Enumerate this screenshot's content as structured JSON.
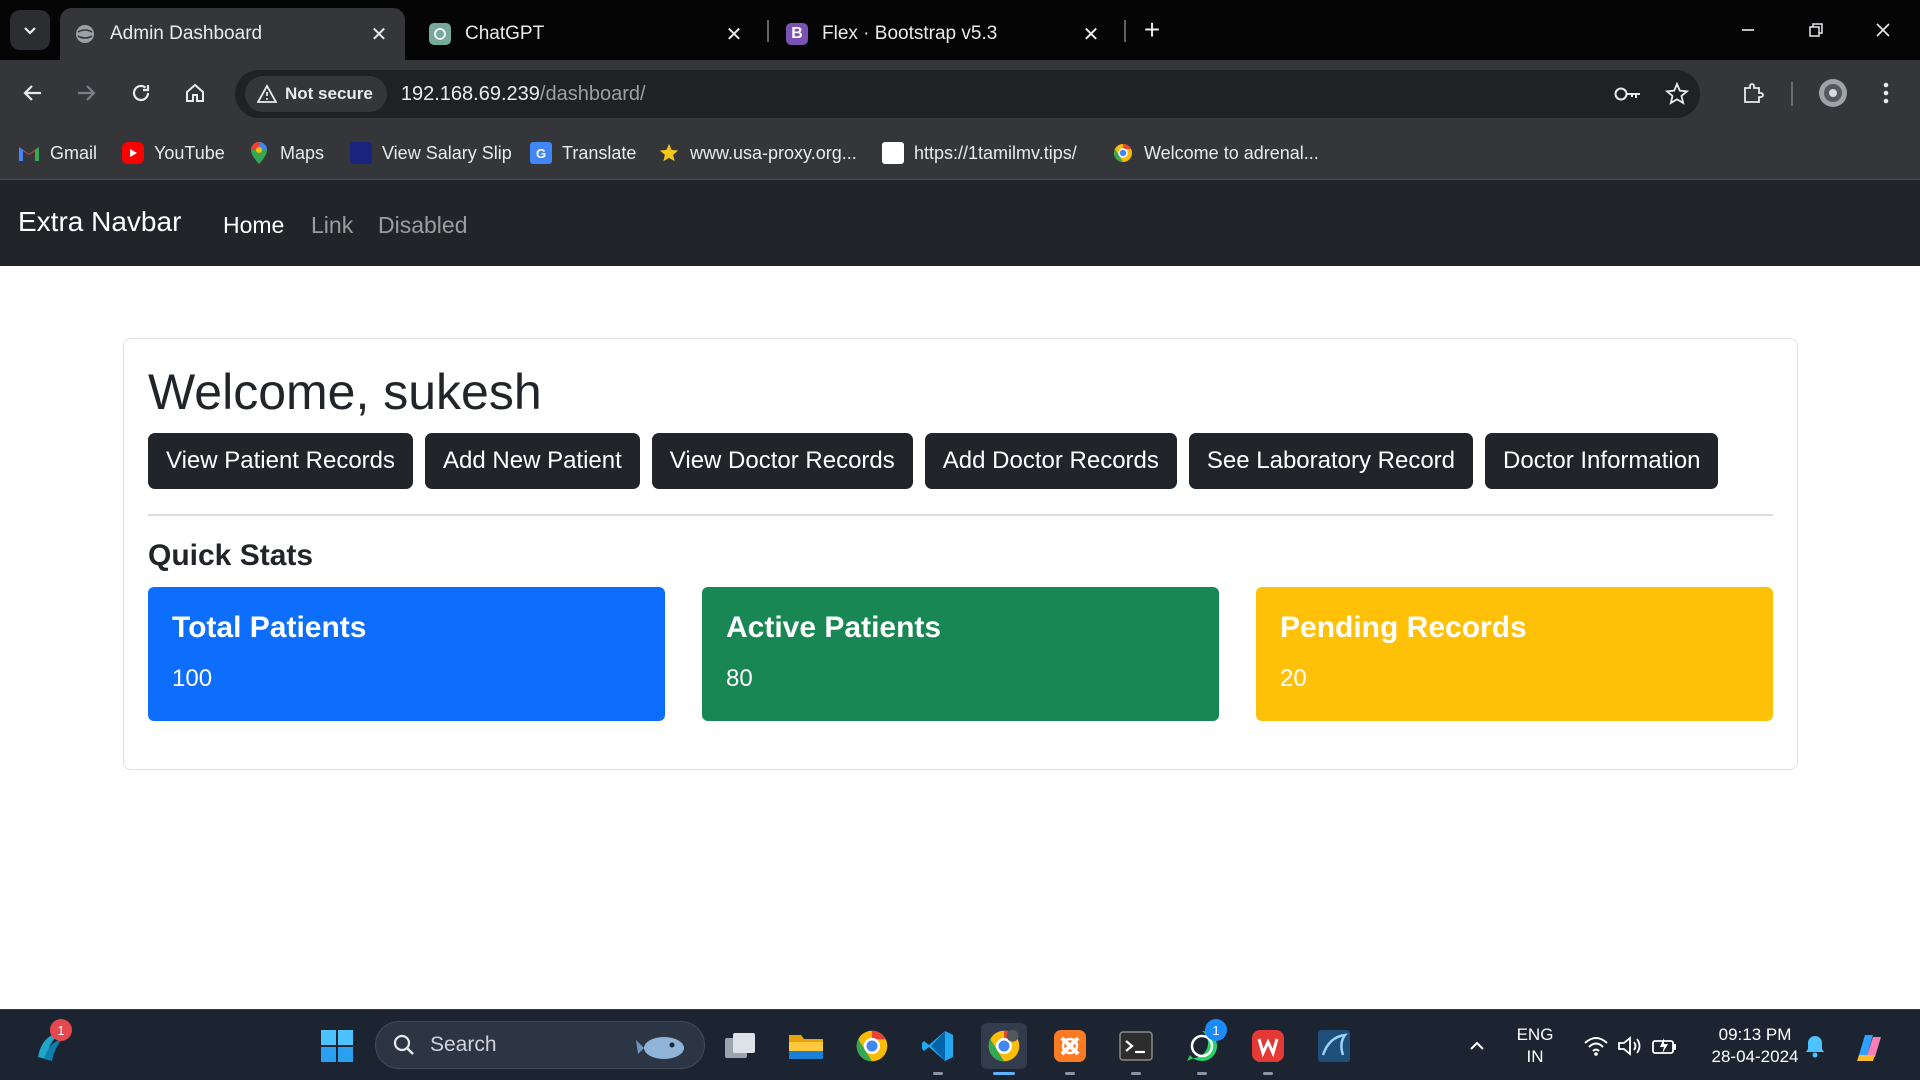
{
  "browser": {
    "tabs": [
      {
        "title": "Admin Dashboard",
        "active": true
      },
      {
        "title": "ChatGPT",
        "active": false
      },
      {
        "title": "Flex · Bootstrap v5.3",
        "active": false
      }
    ],
    "security_label": "Not secure",
    "url_host": "192.168.69.239",
    "url_path": "/dashboard/",
    "bookmarks": [
      "Gmail",
      "YouTube",
      "Maps",
      "View Salary Slip",
      "Translate",
      "www.usa-proxy.org...",
      "https://1tamilmv.tips/",
      "Welcome to adrenal..."
    ]
  },
  "site": {
    "brand": "Extra Navbar",
    "nav": [
      "Home",
      "Link",
      "Disabled"
    ],
    "welcome": "Welcome, sukesh",
    "actions": [
      "View Patient Records",
      "Add New Patient",
      "View Doctor Records",
      "Add Doctor Records",
      "See Laboratory Record",
      "Doctor Information"
    ],
    "quick_stats_heading": "Quick Stats",
    "stats": [
      {
        "title": "Total Patients",
        "value": "100",
        "color": "#0d6efd"
      },
      {
        "title": "Active Patients",
        "value": "80",
        "color": "#198754"
      },
      {
        "title": "Pending Records",
        "value": "20",
        "color": "#ffc107"
      }
    ]
  },
  "taskbar": {
    "search_label": "Search",
    "widgets_badge": "1",
    "whatsapp_badge": "1",
    "language": "ENG",
    "region": "IN",
    "time": "09:13 PM",
    "date": "28-04-2024"
  }
}
